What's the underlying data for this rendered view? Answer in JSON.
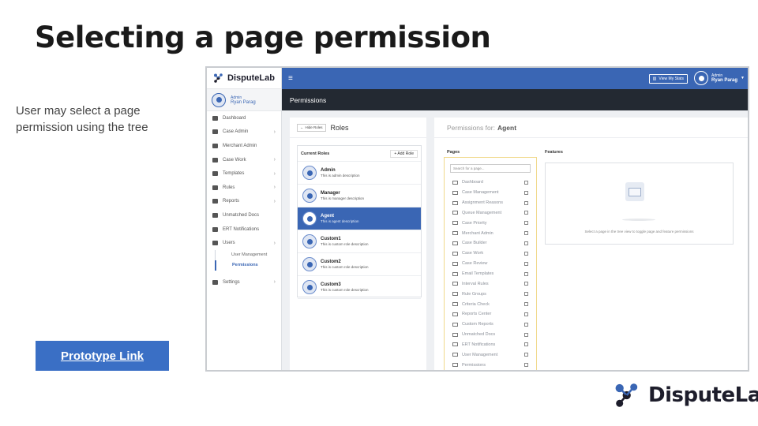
{
  "slide": {
    "title": "Selecting a page permission",
    "description": "User may select a page permission using the tree",
    "prototype_link": "Prototype Link",
    "brand": "DisputeLab"
  },
  "app": {
    "logo": "DisputeLab",
    "user": {
      "role": "Admin",
      "name": "Ryan Parag"
    },
    "topbar": {
      "stats_button": "View My Stats",
      "role": "Admin",
      "name": "Ryan Parag"
    },
    "page_title": "Permissions",
    "sidebar": {
      "items": [
        {
          "label": "Dashboard",
          "icon": "home-icon",
          "chevron": false
        },
        {
          "label": "Case Admin",
          "icon": "briefcase-icon",
          "chevron": true
        },
        {
          "label": "Merchant Admin",
          "icon": "building-icon",
          "chevron": false
        },
        {
          "label": "Case Work",
          "icon": "edit-icon",
          "chevron": true
        },
        {
          "label": "Templates",
          "icon": "envelope-icon",
          "chevron": true
        },
        {
          "label": "Rules",
          "icon": "gear-icon",
          "chevron": true
        },
        {
          "label": "Reports",
          "icon": "file-icon",
          "chevron": true
        },
        {
          "label": "Unmatched Docs",
          "icon": "file-icon",
          "chevron": false
        },
        {
          "label": "ERT Notifications",
          "icon": "warning-icon",
          "chevron": false
        },
        {
          "label": "Users",
          "icon": "users-icon",
          "chevron": true
        }
      ],
      "users_sub": [
        "User Management",
        "Permissions"
      ],
      "settings": "Settings"
    },
    "roles": {
      "hide_button": "Hide Roles",
      "title": "Roles",
      "current_roles": "Current Roles",
      "add_role": "Add Role",
      "list": [
        {
          "name": "Admin",
          "desc": "This is admin description",
          "active": false
        },
        {
          "name": "Manager",
          "desc": "This is manager description",
          "active": false
        },
        {
          "name": "Agent",
          "desc": "This is agent description",
          "active": true
        },
        {
          "name": "Custom1",
          "desc": "This is custom role description",
          "active": false
        },
        {
          "name": "Custom2",
          "desc": "This is custom role description",
          "active": false
        },
        {
          "name": "Custom3",
          "desc": "This is custom role description",
          "active": false
        }
      ]
    },
    "permissions": {
      "label": "Permissions for:",
      "role": "Agent",
      "pages_title": "Pages",
      "features_title": "Features",
      "search_placeholder": "Search for a page...",
      "pages": [
        "Dashboard",
        "Case Management",
        "Assignment Reasons",
        "Queue Management",
        "Case Priority",
        "Merchant Admin",
        "Case Builder",
        "Case Work",
        "Case Review",
        "Email Templates",
        "Interval Rules",
        "Rule Groups",
        "Criteria Check",
        "Reports Center",
        "Custom Reports",
        "Unmatched Docs",
        "ERT Notifications",
        "User Management",
        "Permissions"
      ],
      "features_empty": "Select a page in the tree view to toggle page and feature permissions"
    }
  },
  "colors": {
    "primary": "#3a66b4",
    "dark_bar": "#232932",
    "link_button": "#3a6fc5"
  }
}
